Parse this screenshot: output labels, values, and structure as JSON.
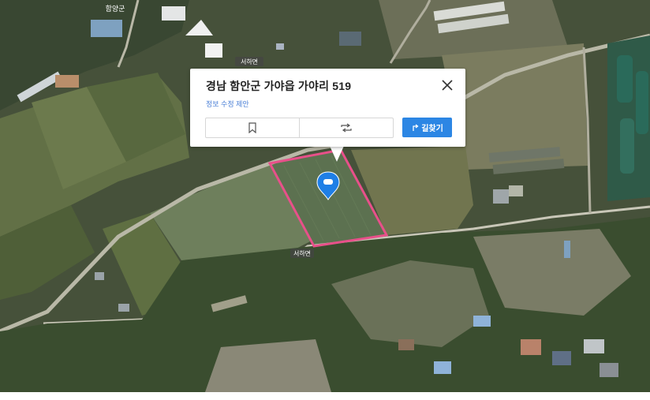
{
  "map": {
    "labels": [
      "서하면",
      "서하면",
      "함양군"
    ],
    "parcel_color": "#e8508a",
    "marker_color": "#1f7fe6"
  },
  "popup": {
    "address": "경남 함안군 가야읍 가야리 519",
    "suggest_edit": "정보 수정 제안",
    "save_icon": "bookmark-icon",
    "share_icon": "share-icon",
    "route_label": "길찾기",
    "route_color": "#2c86e4"
  }
}
